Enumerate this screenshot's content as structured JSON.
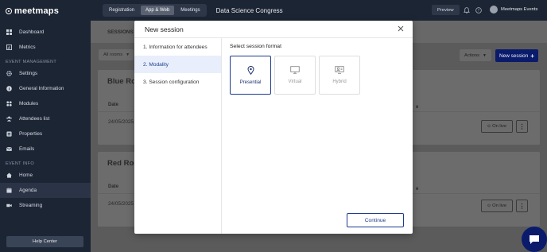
{
  "app": {
    "logo_text": "meetmaps"
  },
  "sidebar": {
    "items_top": [
      {
        "label": "Dashboard",
        "icon": "dashboard-icon"
      },
      {
        "label": "Metrics",
        "icon": "chart-icon"
      }
    ],
    "section_management": "EVENT MANAGEMENT",
    "items_management": [
      {
        "label": "Settings",
        "icon": "gear-icon"
      },
      {
        "label": "General Information",
        "icon": "info-icon"
      },
      {
        "label": "Modules",
        "icon": "grid-icon"
      },
      {
        "label": "Attendees list",
        "icon": "users-icon"
      },
      {
        "label": "Properties",
        "icon": "list-icon"
      },
      {
        "label": "Emails",
        "icon": "mail-icon"
      }
    ],
    "section_info": "EVENT INFO",
    "items_info": [
      {
        "label": "Home",
        "icon": "home-icon"
      },
      {
        "label": "Agenda",
        "icon": "calendar-icon",
        "active": true
      },
      {
        "label": "Streaming",
        "icon": "video-icon"
      }
    ],
    "help_center": "Help Center"
  },
  "topbar": {
    "tabs": [
      "Registration",
      "App & Web",
      "Meetings"
    ],
    "active_tab": "App & Web",
    "event_title": "Data Science Congress",
    "preview": "Preview",
    "profile_name": "Meetmaps Events"
  },
  "main": {
    "subtab": "SESSIONS",
    "filter": "All rooms",
    "actions": "Actions",
    "new_session": "New session",
    "rooms": [
      {
        "title": "Blue Room",
        "date_header": "Date",
        "date": "24/05/2025",
        "col_frag": "e",
        "on_live": "On live"
      },
      {
        "title": "Red Room",
        "date_header": "Date",
        "date": "24/05/2025",
        "col_frag": "e",
        "on_live": "On live"
      }
    ]
  },
  "modal": {
    "title": "New session",
    "steps": [
      "1. Information for attendees",
      "2. Modality",
      "3. Session configuration"
    ],
    "active_step": 1,
    "format_label": "Select session format",
    "formats": [
      {
        "label": "Presential",
        "icon": "location-pin-icon",
        "selected": true
      },
      {
        "label": "Virtual",
        "icon": "monitor-icon",
        "selected": false
      },
      {
        "label": "Hybrid",
        "icon": "hybrid-screen-icon",
        "selected": false
      }
    ],
    "continue": "Continue"
  },
  "colors": {
    "sidebar_bg": "#1c2534",
    "primary": "#0b1b6b",
    "accent_border": "#1d3b8f",
    "active_step_bg": "#e8eefb"
  }
}
